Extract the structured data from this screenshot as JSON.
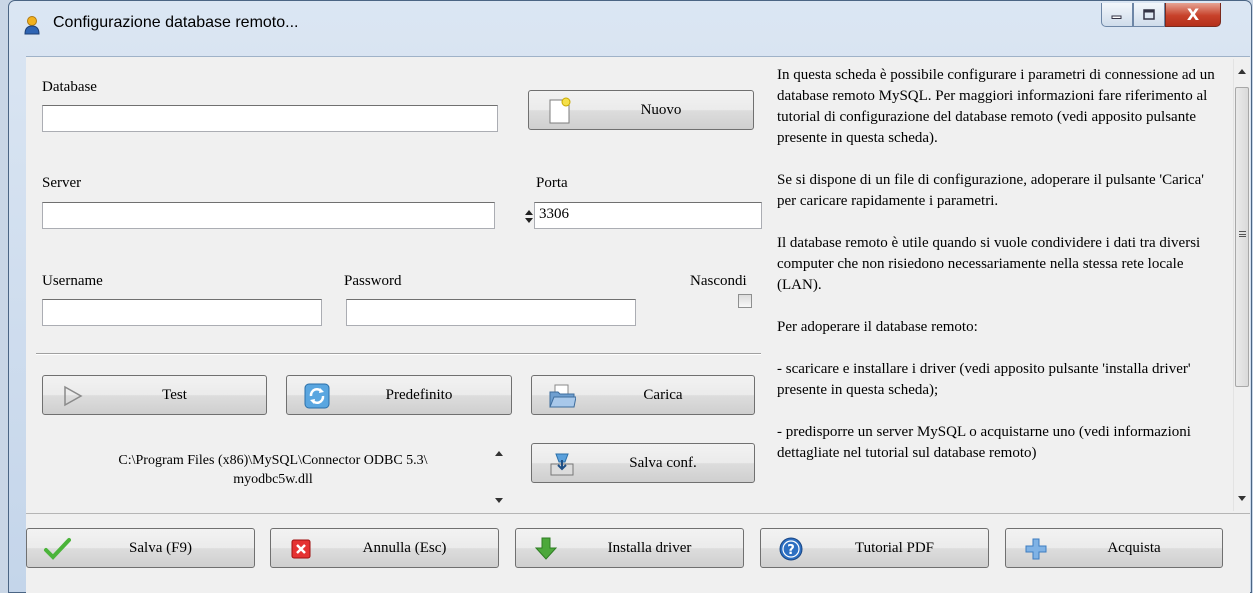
{
  "window": {
    "title": "Configurazione database remoto...",
    "close_glyph": "X"
  },
  "form": {
    "database_label": "Database",
    "database_value": "",
    "new_button": "Nuovo",
    "server_label": "Server",
    "server_value": "",
    "port_label": "Porta",
    "port_value": "3306",
    "username_label": "Username",
    "username_value": "",
    "password_label": "Password",
    "password_value": "",
    "hide_label": "Nascondi",
    "hide_checked": false,
    "test_button": "Test",
    "default_button": "Predefinito",
    "load_button": "Carica",
    "save_conf_button": "Salva conf.",
    "driver_path_line1": "C:\\Program Files (x86)\\MySQL\\Connector ODBC 5.3\\",
    "driver_path_line2": "myodbc5w.dll"
  },
  "info": {
    "paragraphs": [
      "In questa scheda è possibile configurare i parametri di connessione ad un database remoto MySQL. Per maggiori informazioni fare riferimento al tutorial di configurazione del database remoto (vedi apposito pulsante presente in questa scheda).",
      "Se si dispone di un file di configurazione, adoperare il pulsante 'Carica' per caricare rapidamente  i parametri.",
      "Il database remoto è utile quando si vuole condividere i dati tra diversi computer che non risiedono necessariamente nella stessa rete locale (LAN).",
      "Per adoperare il database remoto:",
      "- scaricare e installare i driver (vedi apposito pulsante 'installa driver' presente in questa scheda);",
      "- predisporre un server MySQL o acquistarne uno (vedi informazioni dettagliate nel tutorial sul database remoto)"
    ]
  },
  "footer": {
    "save": "Salva (F9)",
    "cancel": "Annulla (Esc)",
    "install_driver": "Installa driver",
    "tutorial": "Tutorial PDF",
    "buy": "Acquista"
  },
  "colors": {
    "title_bg": "#dbe6f3",
    "close_red": "#c7412a",
    "panel_bg": "#f0f0f0"
  }
}
